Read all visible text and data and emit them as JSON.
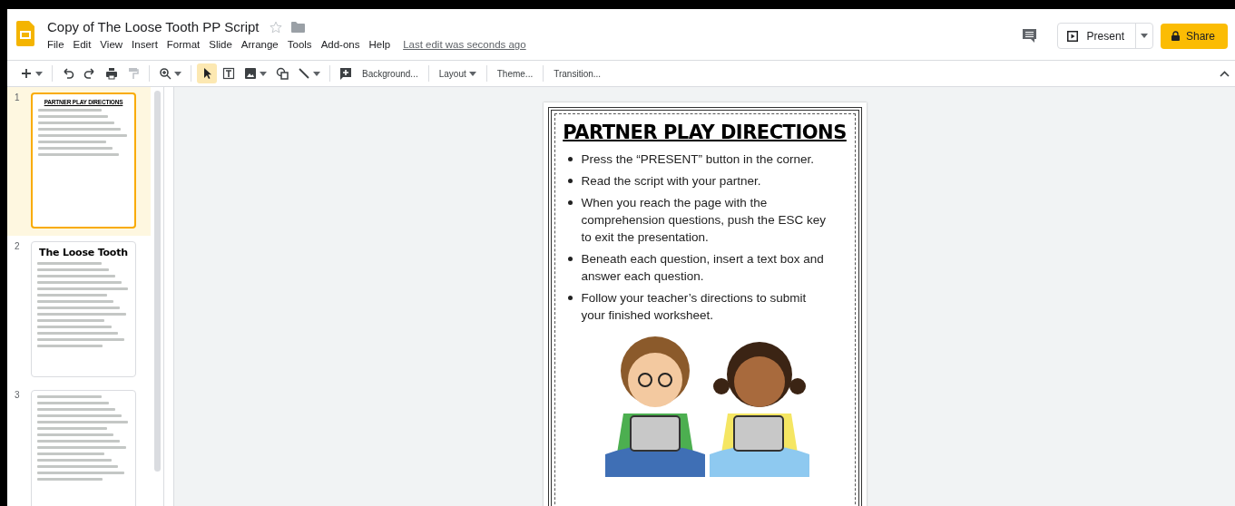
{
  "document": {
    "title": "Copy of The Loose Tooth PP Script",
    "starred": false
  },
  "menu": [
    "File",
    "Edit",
    "View",
    "Insert",
    "Format",
    "Slide",
    "Arrange",
    "Tools",
    "Add-ons",
    "Help"
  ],
  "last_edit": "Last edit was seconds ago",
  "present_button": "Present",
  "share_button": "Share",
  "tools": [
    {
      "kind": "new-slide",
      "selected": false
    },
    {
      "kind": "undo",
      "selected": false
    },
    {
      "kind": "redo",
      "selected": false
    },
    {
      "kind": "print",
      "selected": false
    },
    {
      "kind": "paint-format",
      "selected": false
    },
    {
      "kind": "zoom",
      "selected": false
    },
    {
      "kind": "select",
      "selected": true
    },
    {
      "kind": "textbox",
      "selected": false
    },
    {
      "kind": "image",
      "selected": false
    },
    {
      "kind": "shape",
      "selected": false
    },
    {
      "kind": "line",
      "selected": false
    },
    {
      "kind": "comment",
      "selected": false
    }
  ],
  "toolbar_buttons": [
    {
      "label": "Background...",
      "dropdown": false
    },
    {
      "label": "Layout",
      "dropdown": true
    },
    {
      "label": "Theme...",
      "dropdown": false
    },
    {
      "label": "Transition...",
      "dropdown": false
    }
  ],
  "slides": [
    {
      "number": "1",
      "selected": true,
      "kind": "directions",
      "title": "PARTNER PLAY DIRECTIONS"
    },
    {
      "number": "2",
      "selected": false,
      "kind": "script",
      "title": "The Loose Tooth"
    },
    {
      "number": "3",
      "selected": false,
      "kind": "script-continued"
    }
  ],
  "slide": {
    "heading": "PARTNER PLAY DIRECTIONS",
    "bullets": [
      "Press the “PRESENT” button in the corner.",
      "Read the script with your partner.",
      "When you reach the page with the comprehension questions, push the ESC key to exit the presentation.",
      "Beneath each question, insert a text box and answer each question.",
      "Follow your teacher’s directions to submit your finished worksheet."
    ]
  }
}
